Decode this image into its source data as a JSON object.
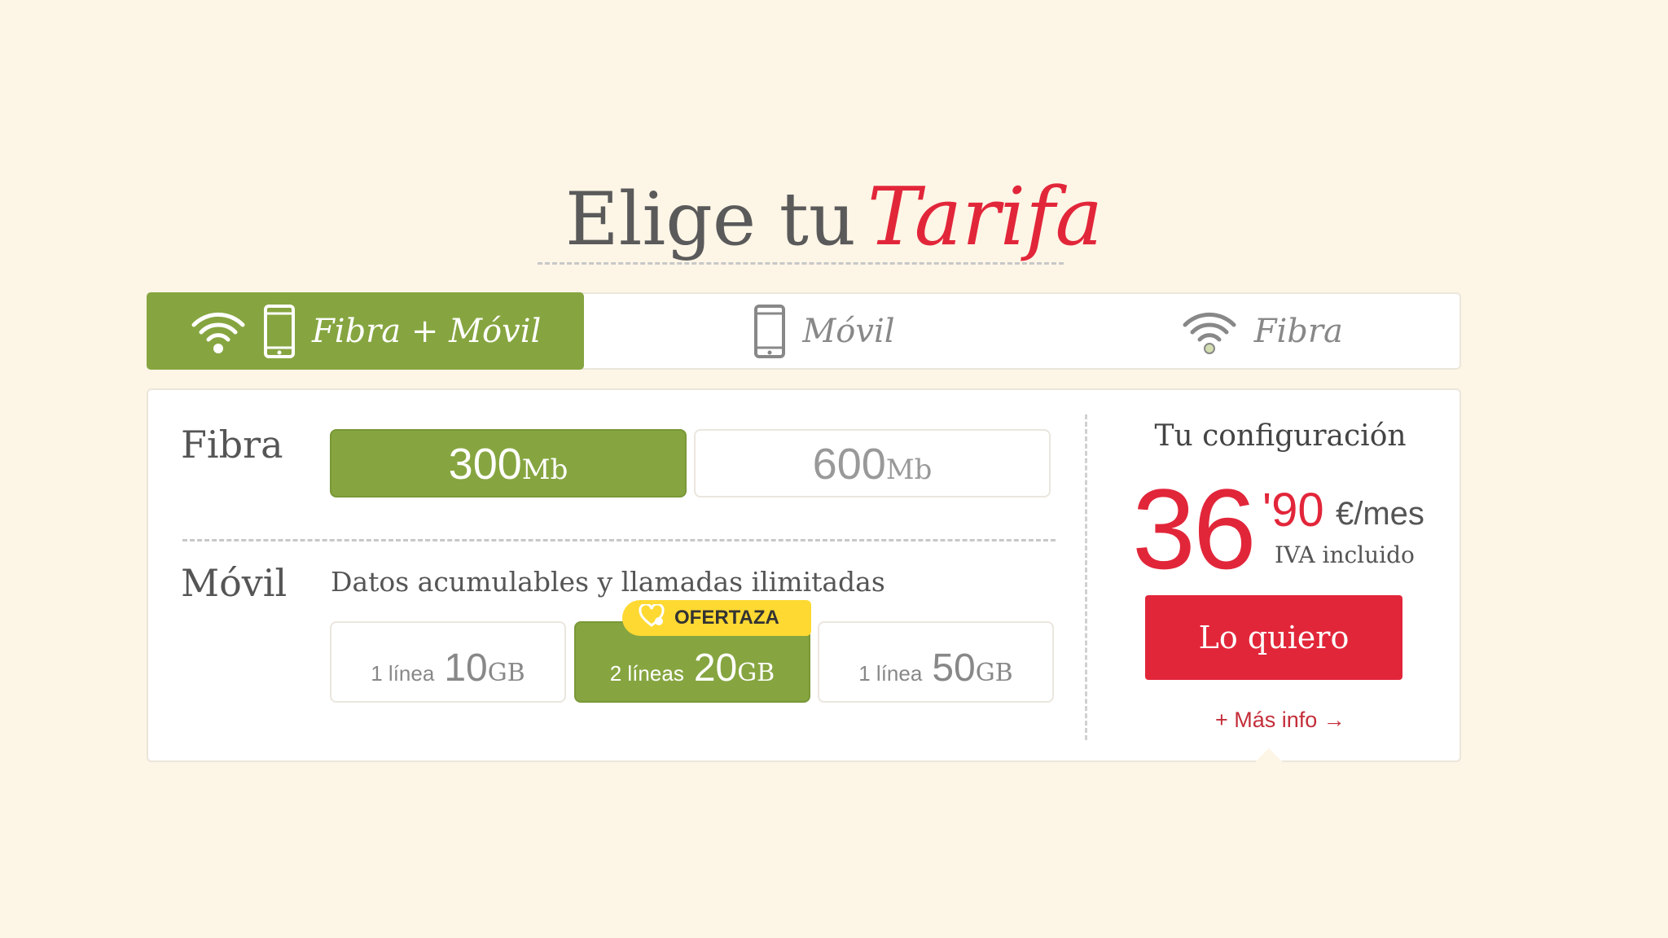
{
  "heading": {
    "plain": "Elige tu",
    "script": "Tarifa"
  },
  "tabs": [
    {
      "label": "Fibra + Móvil",
      "active": true
    },
    {
      "label": "Móvil",
      "active": false
    },
    {
      "label": "Fibra",
      "active": false
    }
  ],
  "fibra": {
    "label": "Fibra",
    "options": [
      {
        "num": "300",
        "unit": "Mb",
        "selected": true
      },
      {
        "num": "600",
        "unit": "Mb",
        "selected": false
      }
    ]
  },
  "movil": {
    "label": "Móvil",
    "description": "Datos acumulables y llamadas ilimitadas",
    "badge": "OFERTAZA",
    "plans": [
      {
        "lines": "1 línea",
        "gb": "10",
        "unit": "GB",
        "selected": false
      },
      {
        "lines": "2 líneas",
        "gb": "20",
        "unit": "GB",
        "selected": true
      },
      {
        "lines": "1 línea",
        "gb": "50",
        "unit": "GB",
        "selected": false
      }
    ]
  },
  "config": {
    "title": "Tu configuración",
    "price_int": "36",
    "price_cents": "'90",
    "price_unit": "€/mes",
    "tax_note": "IVA incluido",
    "cta": "Lo quiero",
    "more_info": "+ Más info →"
  },
  "colors": {
    "green": "#86a540",
    "red": "#e2263a",
    "yellow": "#fed932",
    "background": "#fdf5e6"
  },
  "icons": [
    "wifi-icon",
    "phone-icon",
    "heart-icon"
  ]
}
